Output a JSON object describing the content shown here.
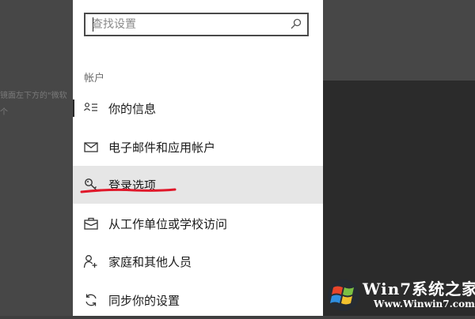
{
  "search": {
    "placeholder": "查找设置",
    "value": ""
  },
  "section": {
    "heading": "帐户"
  },
  "nav": [
    {
      "label": "你的信息",
      "icon": "person-card-icon",
      "selected": false
    },
    {
      "label": "电子邮件和应用帐户",
      "icon": "mail-icon",
      "selected": false
    },
    {
      "label": "登录选项",
      "icon": "key-icon",
      "selected": true
    },
    {
      "label": "从工作单位或学校访问",
      "icon": "briefcase-icon",
      "selected": false
    },
    {
      "label": "家庭和其他人员",
      "icon": "person-add-icon",
      "selected": false
    },
    {
      "label": "同步你的设置",
      "icon": "sync-icon",
      "selected": false
    }
  ],
  "background_text": {
    "line1": "镜面左下方的\"微软",
    "line2": "个"
  },
  "watermark": {
    "line1": "Win7系统之家",
    "line2": "Www.Winwin7.com"
  },
  "colors": {
    "highlight": "#e6e6e6",
    "annotation_red": "#e0182a"
  }
}
